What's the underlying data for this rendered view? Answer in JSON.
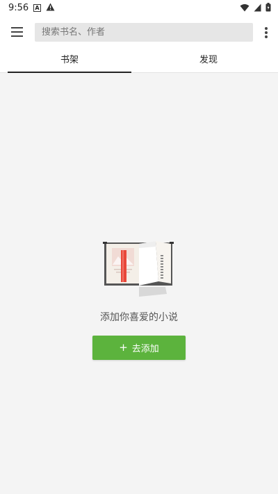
{
  "status_bar": {
    "time": "9:56",
    "icons": [
      "a-notification-icon",
      "warning-icon",
      "wifi-icon",
      "signal-icon",
      "battery-icon"
    ]
  },
  "app_bar": {
    "menu_icon": "hamburger-menu-icon",
    "search_placeholder": "搜索书名、作者",
    "overflow_icon": "more-vertical-icon"
  },
  "tabs": [
    {
      "label": "书架",
      "selected": true
    },
    {
      "label": "发现",
      "selected": false
    }
  ],
  "empty_state": {
    "illustration": "open-book-icon",
    "message": "添加你喜爱的小说",
    "add_button_label": "去添加",
    "add_button_icon": "plus-icon"
  },
  "colors": {
    "accent_green": "#5cb33d",
    "bookmark_red": "#e8473a",
    "background": "#f4f4f4"
  }
}
